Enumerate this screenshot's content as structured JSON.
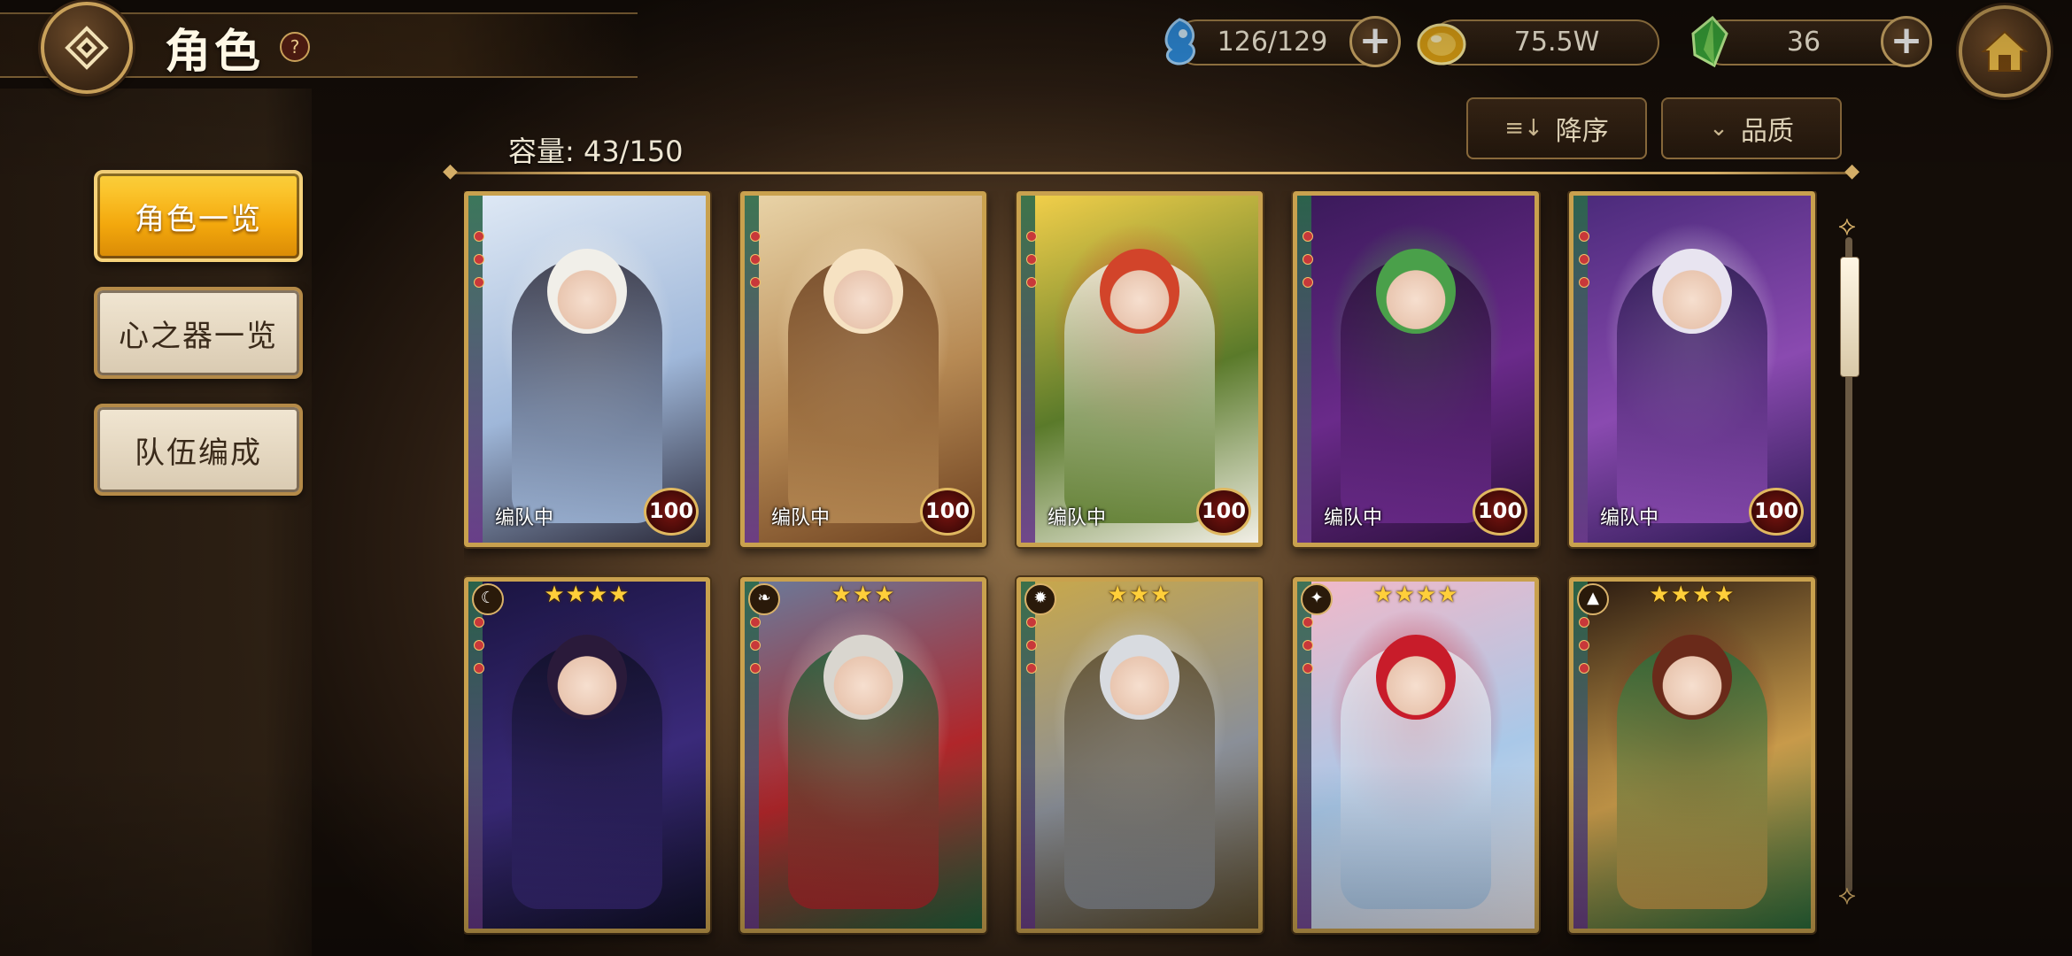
{
  "header": {
    "title": "角色",
    "help_glyph": "?"
  },
  "resources": {
    "stamina": {
      "value": "126/129",
      "icon": "blue-spirit-icon"
    },
    "gold": {
      "value": "75.5W",
      "icon": "gold-coin-icon"
    },
    "gems": {
      "value": "36",
      "icon": "green-crystal-icon"
    },
    "plus_glyph": "+"
  },
  "sidebar": {
    "items": [
      {
        "label": "角色一览",
        "active": true
      },
      {
        "label": "心之器一览",
        "active": false
      },
      {
        "label": "队伍编成",
        "active": false
      }
    ]
  },
  "toolbar": {
    "sort_label": "降序",
    "sort_icon": "≡↓",
    "filter_label": "品质",
    "filter_icon": "⌄"
  },
  "capacity": "容量: 43/150",
  "cards": [
    {
      "status": "编队中",
      "level": "100",
      "stars": "",
      "element": "",
      "palette": [
        "#dfe9f5",
        "#9fb7d9",
        "#2b2a3a",
        "#f1efe9"
      ]
    },
    {
      "status": "编队中",
      "level": "100",
      "stars": "",
      "element": "",
      "palette": [
        "#e9d4a8",
        "#b78a54",
        "#6b3f1e",
        "#f6e2c2"
      ]
    },
    {
      "status": "编队中",
      "level": "100",
      "stars": "",
      "element": "",
      "palette": [
        "#f4d04a",
        "#5a7a2a",
        "#f2efe6",
        "#d2442a"
      ]
    },
    {
      "status": "编队中",
      "level": "100",
      "stars": "",
      "element": "",
      "palette": [
        "#3a1a5a",
        "#6a2a8a",
        "#2a0f3a",
        "#4aa04a"
      ]
    },
    {
      "status": "编队中",
      "level": "100",
      "stars": "",
      "element": "",
      "palette": [
        "#4a2a7a",
        "#8a4ab0",
        "#2a1850",
        "#e8e4f0"
      ]
    },
    {
      "status": "",
      "level": "",
      "stars": "★★★★",
      "element": "☾",
      "palette": [
        "#1a1440",
        "#3a2a7a",
        "#101028",
        "#2a1a3a"
      ]
    },
    {
      "status": "",
      "level": "",
      "stars": "★★★",
      "element": "❧",
      "palette": [
        "#6a7a9a",
        "#b0262a",
        "#20603a",
        "#d9d6cf"
      ]
    },
    {
      "status": "",
      "level": "",
      "stars": "★★★",
      "element": "✹",
      "palette": [
        "#c9a84a",
        "#8a8f98",
        "#5a4a2a",
        "#d8dbe0"
      ]
    },
    {
      "status": "",
      "level": "",
      "stars": "★★★★",
      "element": "✦",
      "palette": [
        "#f2b8c8",
        "#a9c8e8",
        "#e8e4ea",
        "#c81c2a"
      ]
    },
    {
      "status": "",
      "level": "",
      "stars": "★★★★",
      "element": "▲",
      "palette": [
        "#2a1a10",
        "#c89a4a",
        "#2a6a3a",
        "#6a2a1a"
      ]
    }
  ],
  "colors": {
    "accent_gold": "#c9a14e",
    "active_tab": "#f3a80d",
    "level_badge": "#7a1410"
  }
}
